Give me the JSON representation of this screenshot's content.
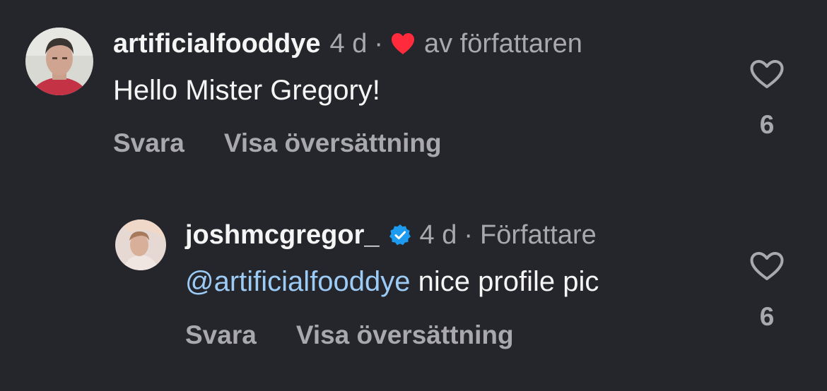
{
  "comments": [
    {
      "username": "artificialfooddye",
      "time": "4 d",
      "separator": "·",
      "author_like_label": "av författaren",
      "text": "Hello Mister Gregory!",
      "reply_label": "Svara",
      "translate_label": "Visa översättning",
      "like_count": "6",
      "liked_by_author": true,
      "verified": false
    },
    {
      "username": "joshmcgregor_",
      "time": "4 d",
      "separator": "·",
      "author_badge": "Författare",
      "mention": "@artificialfooddye",
      "text": " nice profile pic",
      "reply_label": "Svara",
      "translate_label": "Visa översättning",
      "like_count": "6",
      "verified": true
    }
  ],
  "colors": {
    "background": "#25262b",
    "primary_text": "#f5f5f5",
    "secondary_text": "#a8a8ad",
    "mention": "#9ccbf5",
    "heart_red": "#ff2a3c",
    "verified_blue": "#1d9bf0"
  },
  "icons": {
    "author_like": "heart-filled-icon",
    "like": "heart-outline-icon",
    "verified": "verified-badge-icon"
  }
}
